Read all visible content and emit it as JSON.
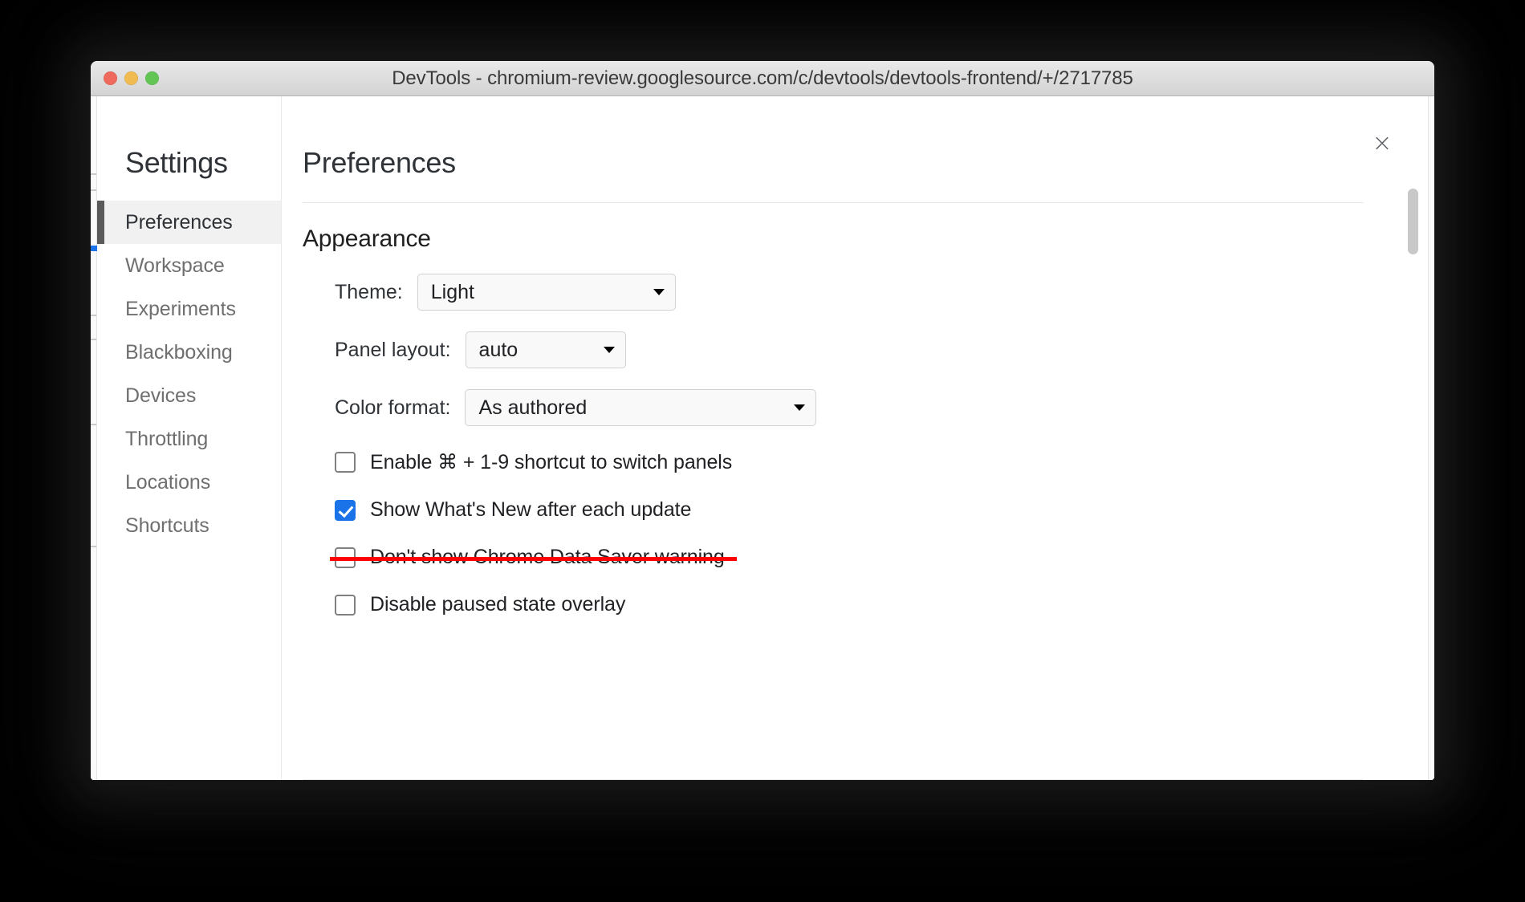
{
  "window": {
    "title": "DevTools - chromium-review.googlesource.com/c/devtools/devtools-frontend/+/2717785",
    "traffic_lights": [
      "close",
      "minimize",
      "zoom"
    ]
  },
  "dialog": {
    "close_label": "×",
    "sidebar": {
      "title": "Settings",
      "items": [
        {
          "label": "Preferences",
          "selected": true
        },
        {
          "label": "Workspace",
          "selected": false
        },
        {
          "label": "Experiments",
          "selected": false
        },
        {
          "label": "Blackboxing",
          "selected": false
        },
        {
          "label": "Devices",
          "selected": false
        },
        {
          "label": "Throttling",
          "selected": false
        },
        {
          "label": "Locations",
          "selected": false
        },
        {
          "label": "Shortcuts",
          "selected": false
        }
      ]
    },
    "content": {
      "title": "Preferences",
      "section_title": "Appearance",
      "fields": [
        {
          "label": "Theme:",
          "value": "Light"
        },
        {
          "label": "Panel layout:",
          "value": "auto"
        },
        {
          "label": "Color format:",
          "value": "As authored"
        }
      ],
      "checkboxes": [
        {
          "label": "Enable ⌘ + 1-9 shortcut to switch panels",
          "checked": false,
          "struck": false
        },
        {
          "label": "Show What's New after each update",
          "checked": true,
          "struck": false
        },
        {
          "label": "Don't show Chrome Data Saver warning",
          "checked": false,
          "struck": true
        },
        {
          "label": "Disable paused state overlay",
          "checked": false,
          "struck": false
        }
      ]
    }
  },
  "colors": {
    "accent_checked": "#1a73e8",
    "annotation_strike": "#ff0000",
    "selected_item_bar": "#5a5a5a",
    "selected_item_bg": "#f1f1f1",
    "page_background": "#000000"
  }
}
